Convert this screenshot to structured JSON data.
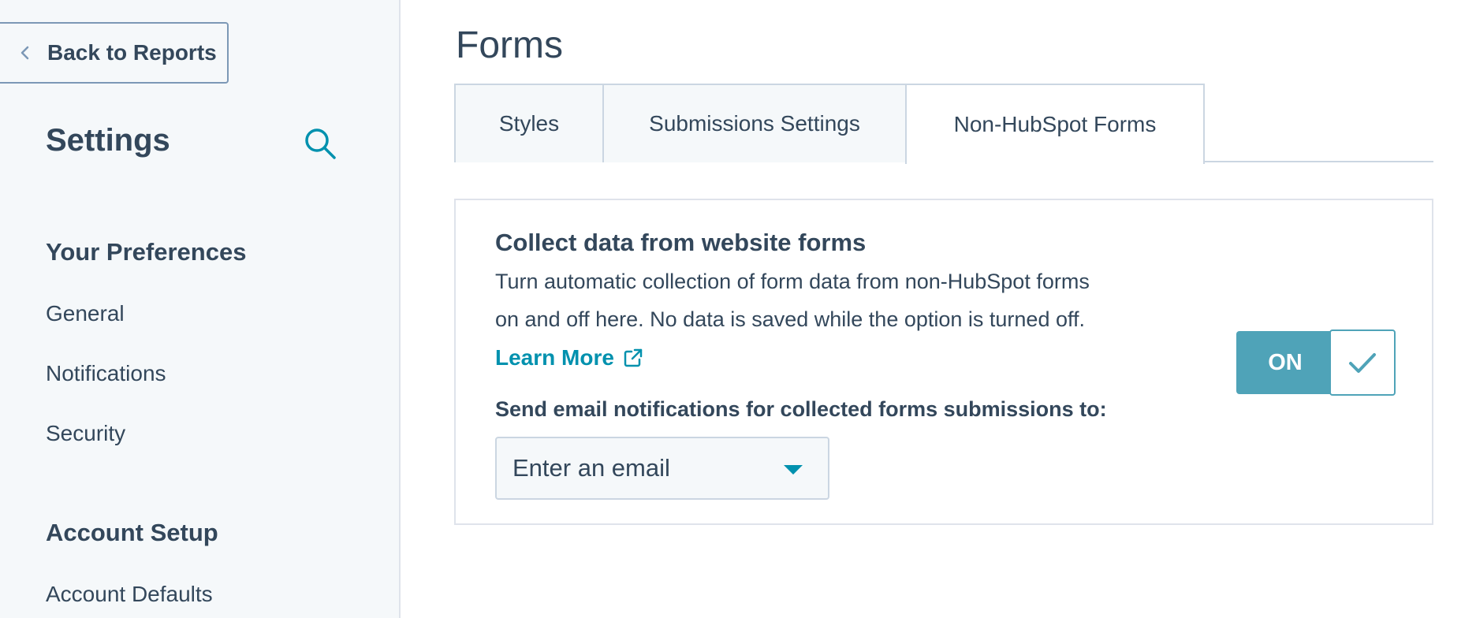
{
  "sidebar": {
    "back_label": "Back to Reports",
    "title": "Settings",
    "sections": [
      {
        "heading": "Your Preferences",
        "items": [
          "General",
          "Notifications",
          "Security"
        ]
      },
      {
        "heading": "Account Setup",
        "items": [
          "Account Defaults"
        ]
      }
    ]
  },
  "main": {
    "title": "Forms",
    "tabs": [
      {
        "label": "Styles",
        "active": false
      },
      {
        "label": "Submissions Settings",
        "active": false
      },
      {
        "label": "Non-HubSpot Forms",
        "active": true
      }
    ],
    "card": {
      "title": "Collect data from website forms",
      "description_line1": "Turn automatic collection of form data from non-HubSpot forms",
      "description_line2": "on and off here. No data is saved while the option is turned off.",
      "learn_more": "Learn More",
      "toggle_label": "ON",
      "toggle_state": true,
      "notification_label": "Send email notifications for collected forms submissions to:",
      "email_placeholder": "Enter an email"
    }
  },
  "colors": {
    "accent": "#0091ae",
    "toggle_on": "#4fa3b8",
    "text": "#33475b",
    "sidebar_bg": "#f5f8fa"
  }
}
